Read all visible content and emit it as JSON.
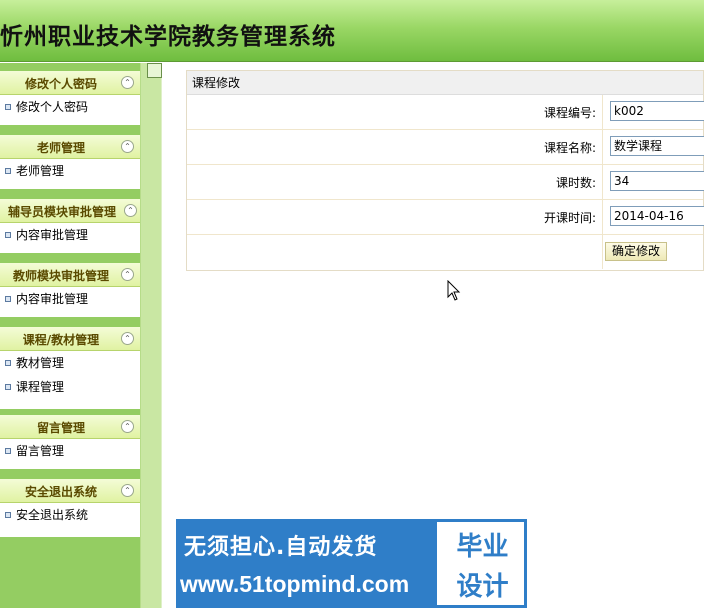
{
  "header": {
    "title": "忻州职业技术学院教务管理系统"
  },
  "sidebar": {
    "groups": [
      {
        "title": "修改个人密码",
        "toggle": "⌃",
        "items": [
          {
            "label": "修改个人密码"
          }
        ]
      },
      {
        "title": "老师管理",
        "toggle": "⌃",
        "items": [
          {
            "label": "老师管理"
          }
        ]
      },
      {
        "title": "辅导员模块审批管理",
        "toggle": "⌃",
        "items": [
          {
            "label": "内容审批管理"
          }
        ]
      },
      {
        "title": "教师模块审批管理",
        "toggle": "⌃",
        "items": [
          {
            "label": "内容审批管理"
          }
        ]
      },
      {
        "title": "课程/教材管理",
        "toggle": "⌃",
        "items": [
          {
            "label": "教材管理"
          },
          {
            "label": "课程管理"
          }
        ]
      },
      {
        "title": "留言管理",
        "toggle": "⌃",
        "items": [
          {
            "label": "留言管理"
          }
        ]
      },
      {
        "title": "安全退出系统",
        "toggle": "⌃",
        "items": [
          {
            "label": "安全退出系统"
          }
        ]
      }
    ]
  },
  "form": {
    "title": "课程修改",
    "fields": [
      {
        "label": "课程编号:",
        "value": "k002"
      },
      {
        "label": "课程名称:",
        "value": "数学课程"
      },
      {
        "label": "课时数:",
        "value": "34"
      },
      {
        "label": "开课时间:",
        "value": "2014-04-16"
      }
    ],
    "submit_label": "确定修改"
  },
  "watermark": {
    "slogan": "无须担心.自动发货",
    "url": "www.51topmind.com",
    "badge_line1": "毕业",
    "badge_line2": "设计"
  },
  "colors": {
    "header_green": "#9ad765",
    "sidebar_green": "#94cd62",
    "watermark_blue": "#2f7ec8"
  }
}
